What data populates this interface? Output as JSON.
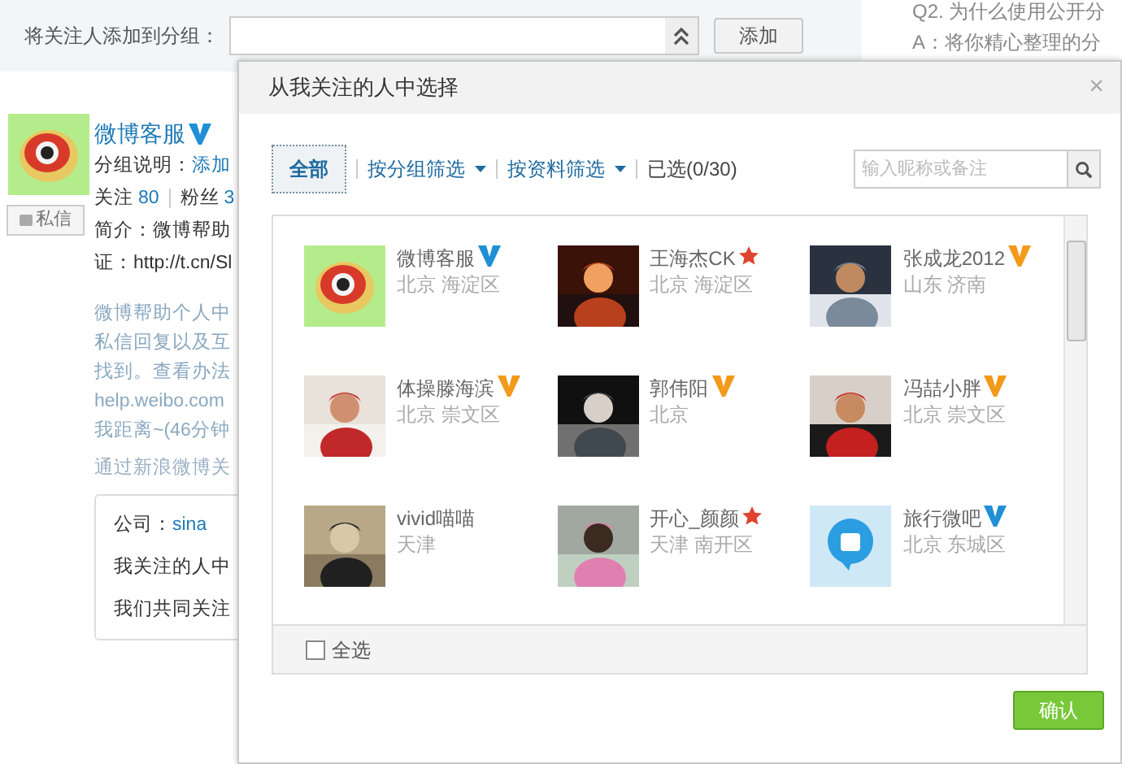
{
  "page": {
    "group_label": "将关注人添加到分组：",
    "add_button": "添加",
    "faq": [
      "Q2. 为什么使用公开分",
      "A：将你精心整理的分"
    ],
    "profile": {
      "name": "微博客服",
      "kind": "blue_v",
      "group_note_label": "分组说明：",
      "group_note_link": "添加",
      "follow_label": "关注",
      "follow_count": "80",
      "fans_label": "粉丝",
      "fans_count": "3",
      "message_button": "私信",
      "intro": [
        "简介：微博帮助",
        "证：http://t.cn/Sl"
      ],
      "description": [
        "微博帮助个人中",
        "私信回复以及互",
        "找到。查看办法",
        "help.weibo.com",
        "我距离~(46分钟"
      ],
      "via": "通过新浪微博关",
      "card": {
        "company_label": "公司：",
        "company": "sina",
        "lines": [
          "我关注的人中",
          "我们共同关注"
        ]
      }
    }
  },
  "dialog": {
    "title": "从我关注的人中选择",
    "close": "×",
    "filters": [
      {
        "label": "全部",
        "selected": true,
        "dropdown": false
      },
      {
        "label": "按分组筛选",
        "selected": false,
        "dropdown": true
      },
      {
        "label": "按资料筛选",
        "selected": false,
        "dropdown": true
      }
    ],
    "selected_count": "已选(0/30)",
    "search": {
      "placeholder": "输入昵称或备注"
    },
    "people": [
      {
        "name": "微博客服",
        "kind": "blue_v",
        "location": "北京 海淀区"
      },
      {
        "name": "王海杰CK",
        "kind": "red_star",
        "location": "北京 海淀区"
      },
      {
        "name": "张成龙2012",
        "kind": "orange_v",
        "location": "山东 济南"
      },
      {
        "name": "体操滕海滨",
        "kind": "orange_v",
        "location": "北京 崇文区"
      },
      {
        "name": "郭伟阳",
        "kind": "orange_v",
        "location": "北京"
      },
      {
        "name": "冯喆小胖",
        "kind": "orange_v",
        "location": "北京 崇文区"
      },
      {
        "name": "vivid喵喵",
        "kind": "plain",
        "location": "天津"
      },
      {
        "name": "开心_颜颜",
        "kind": "red_star",
        "location": "天津 南开区"
      },
      {
        "name": "旅行微吧",
        "kind": "blue_v",
        "location": "北京 东城区"
      }
    ],
    "select_all": {
      "label": "全选",
      "checked": false
    },
    "confirm_button": "确认"
  }
}
